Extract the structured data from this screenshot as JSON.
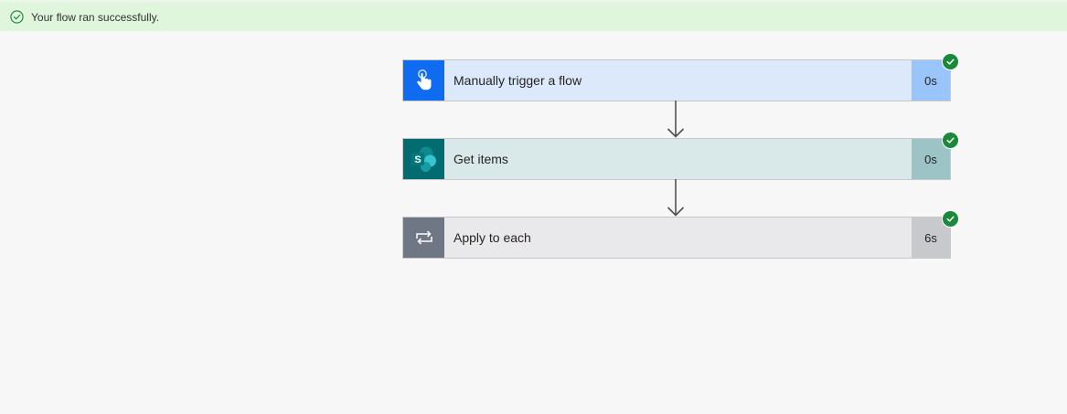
{
  "banner": {
    "message": "Your flow ran successfully.",
    "icon": "check-circle-icon",
    "color": "#dff6dd"
  },
  "steps": [
    {
      "label": "Manually trigger a flow",
      "duration": "0s",
      "icon": "hand-touch-icon",
      "icon_bg": "#0f6cf0",
      "body_bg": "#dbe9fb",
      "duration_bg": "#99c5fa",
      "status": "success"
    },
    {
      "label": "Get items",
      "duration": "0s",
      "icon": "sharepoint-icon",
      "icon_bg": "#036c70",
      "body_bg": "#d9e8e8",
      "duration_bg": "#9cc4c6",
      "status": "success"
    },
    {
      "label": "Apply to each",
      "duration": "6s",
      "icon": "loop-icon",
      "icon_bg": "#6e7783",
      "body_bg": "#e9e9eb",
      "duration_bg": "#c7c9cd",
      "status": "success"
    }
  ],
  "colors": {
    "success": "#1a8a3a",
    "connector": "#505050"
  }
}
